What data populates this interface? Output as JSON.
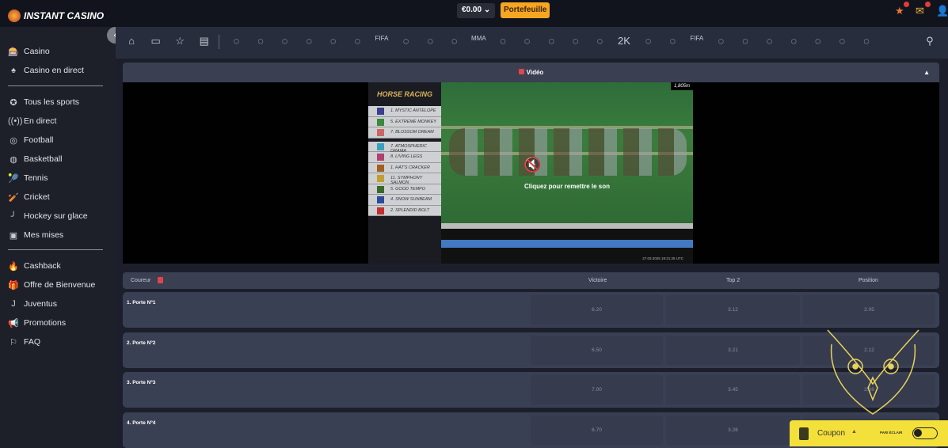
{
  "brand": {
    "name": "INSTANT CASINO"
  },
  "header": {
    "balance": "€0.00",
    "wallet_label": "Portefeuille"
  },
  "sidebar": {
    "top": [
      {
        "label": "Casino",
        "icon": "slot-icon"
      },
      {
        "label": "Casino en direct",
        "icon": "card-icon"
      }
    ],
    "sports": [
      {
        "label": "Tous les sports",
        "icon": "star-icon"
      },
      {
        "label": "En direct",
        "icon": "live-icon"
      },
      {
        "label": "Football",
        "icon": "football-icon"
      },
      {
        "label": "Basketball",
        "icon": "basketball-icon"
      },
      {
        "label": "Tennis",
        "icon": "tennis-icon"
      },
      {
        "label": "Cricket",
        "icon": "cricket-icon"
      },
      {
        "label": "Hockey sur glace",
        "icon": "hockey-icon"
      },
      {
        "label": "Mes mises",
        "icon": "bets-icon"
      }
    ],
    "extras": [
      {
        "label": "Cashback",
        "icon": "fire-icon"
      },
      {
        "label": "Offre de Bienvenue",
        "icon": "gift-icon"
      },
      {
        "label": "Juventus",
        "icon": "juventus-icon"
      },
      {
        "label": "Promotions",
        "icon": "megaphone-icon"
      },
      {
        "label": "FAQ",
        "icon": "whistle-icon"
      }
    ]
  },
  "sportnav": [
    "home",
    "live",
    "favorites",
    "betslip",
    "football",
    "tennis",
    "basketball",
    "hockey",
    "cricket",
    "table-tennis",
    "fifa",
    "counter-strike",
    "horse-racing",
    "baseball",
    "mma",
    "rugby",
    "darts",
    "badminton",
    "volleyball",
    "handball",
    "nba2k",
    "esports",
    "league-of-legends",
    "volta-fifa",
    "swimming",
    "american-football",
    "motorsport",
    "golf",
    "rocket-league",
    "snooker",
    "virtual-horse-racing"
  ],
  "video": {
    "title": "Vidéo",
    "unmute_text": "Cliquez pour remettre le son",
    "game_title": "HORSE RACING",
    "distance": "1,805m",
    "horses": [
      "1. MYSTIC ANTELOPE",
      "5. EXTREME MONKEY",
      "7. BLOSSOM DREAM",
      "7. ATMOSPHERIC DRAMA",
      "8. LIVING LEGS",
      "1. HAT'S CRACKER",
      "11. SYMPHONY SALMON",
      "5. GOOD TEMPO",
      "4. SNOW SUNBEAM",
      "2. SPLENDID BOLT"
    ],
    "timestamp": "27.03.2025 19:21:25 UTC"
  },
  "table": {
    "headers": {
      "runner": "Coureur",
      "win": "Victoire",
      "top2": "Top 2",
      "place": "Position"
    },
    "rows": [
      {
        "name": "1. Porte Nº1",
        "win": "6.20",
        "top2": "3.12",
        "place": "2.05"
      },
      {
        "name": "2. Porte Nº2",
        "win": "6.50",
        "top2": "3.21",
        "place": "2.12"
      },
      {
        "name": "3. Porte Nº3",
        "win": "7.00",
        "top2": "3.45",
        "place": "2.08"
      },
      {
        "name": "4. Porte Nº4",
        "win": "6.70",
        "top2": "3.26",
        "place": ""
      }
    ]
  },
  "coupon": {
    "label": "Coupon",
    "flash_label": "PARI ÉCLAIR"
  },
  "colors": {
    "accent": "#f5a623",
    "coupon": "#f4e03a",
    "live_red": "#e2444b"
  }
}
